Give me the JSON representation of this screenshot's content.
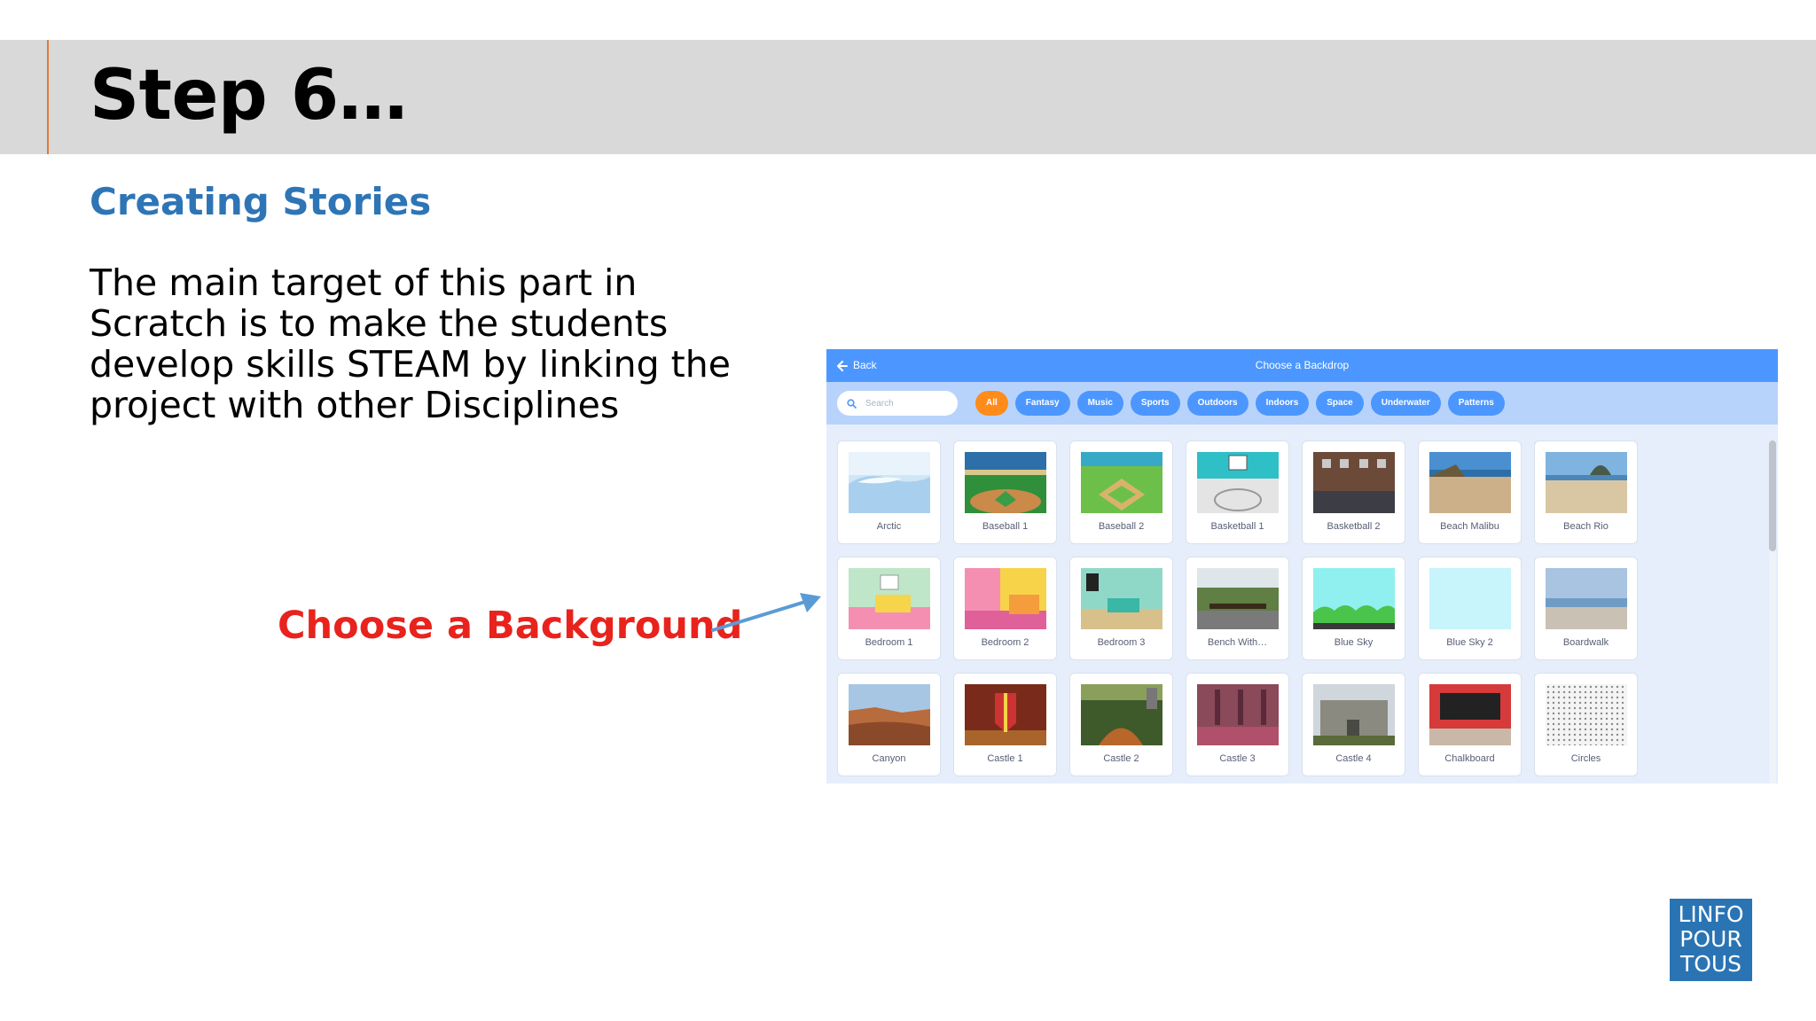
{
  "slide": {
    "title": "Step 6…",
    "subtitle": "Creating Stories",
    "body": "The main target of this part in Scratch is to make the students develop skills STEAM by linking the project with other Disciplines",
    "callout": "Choose a Background"
  },
  "library": {
    "back_label": "Back",
    "title": "Choose a Backdrop",
    "search_placeholder": "Search",
    "tags": [
      "All",
      "Fantasy",
      "Music",
      "Sports",
      "Outdoors",
      "Indoors",
      "Space",
      "Underwater",
      "Patterns"
    ],
    "active_tag": "All",
    "backdrops": [
      "Arctic",
      "Baseball 1",
      "Baseball 2",
      "Basketball 1",
      "Basketball 2",
      "Beach Malibu",
      "Beach Rio",
      "Bedroom 1",
      "Bedroom 2",
      "Bedroom 3",
      "Bench With…",
      "Blue Sky",
      "Blue Sky 2",
      "Boardwalk",
      "Canyon",
      "Castle 1",
      "Castle 2",
      "Castle 3",
      "Castle 4",
      "Chalkboard",
      "Circles"
    ]
  },
  "logo": {
    "lines": [
      "LINFO",
      "POUR",
      "TOUS"
    ]
  },
  "colors": {
    "title_band": "#d9d9d9",
    "accent_line": "#e07b39",
    "subtitle": "#2e75b6",
    "callout": "#e8231d",
    "arrow": "#5b9bd5",
    "scratch_header": "#4c97ff",
    "scratch_filterbar": "#b8d3fb",
    "tag_active": "#ff8c1a",
    "logo_bg": "#2a74b4"
  }
}
